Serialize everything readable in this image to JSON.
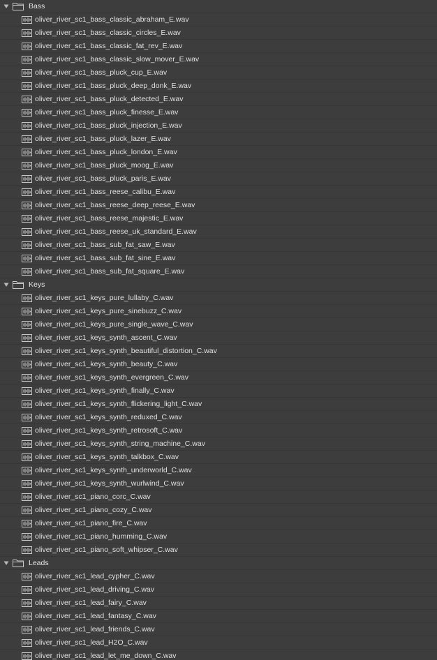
{
  "folders": [
    {
      "name": "Bass",
      "icon": "folder-icon",
      "files": [
        "oliver_river_sc1_bass_classic_abraham_E.wav",
        "oliver_river_sc1_bass_classic_circles_E.wav",
        "oliver_river_sc1_bass_classic_fat_rev_E.wav",
        "oliver_river_sc1_bass_classic_slow_mover_E.wav",
        "oliver_river_sc1_bass_pluck_cup_E.wav",
        "oliver_river_sc1_bass_pluck_deep_donk_E.wav",
        "oliver_river_sc1_bass_pluck_detected_E.wav",
        "oliver_river_sc1_bass_pluck_finesse_E.wav",
        "oliver_river_sc1_bass_pluck_injection_E.wav",
        "oliver_river_sc1_bass_pluck_lazer_E.wav",
        "oliver_river_sc1_bass_pluck_london_E.wav",
        "oliver_river_sc1_bass_pluck_moog_E.wav",
        "oliver_river_sc1_bass_pluck_paris_E.wav",
        "oliver_river_sc1_bass_reese_calibu_E.wav",
        "oliver_river_sc1_bass_reese_deep_reese_E.wav",
        "oliver_river_sc1_bass_reese_majestic_E.wav",
        "oliver_river_sc1_bass_reese_uk_standard_E.wav",
        "oliver_river_sc1_bass_sub_fat_saw_E.wav",
        "oliver_river_sc1_bass_sub_fat_sine_E.wav",
        "oliver_river_sc1_bass_sub_fat_square_E.wav"
      ]
    },
    {
      "name": "Keys",
      "icon": "folder-icon",
      "files": [
        "oliver_river_sc1_keys_pure_lullaby_C.wav",
        "oliver_river_sc1_keys_pure_sinebuzz_C.wav",
        "oliver_river_sc1_keys_pure_single_wave_C.wav",
        "oliver_river_sc1_keys_synth_ascent_C.wav",
        "oliver_river_sc1_keys_synth_beautiful_distortion_C.wav",
        "oliver_river_sc1_keys_synth_beauty_C.wav",
        "oliver_river_sc1_keys_synth_evergreen_C.wav",
        "oliver_river_sc1_keys_synth_finally_C.wav",
        "oliver_river_sc1_keys_synth_flickering_light_C.wav",
        "oliver_river_sc1_keys_synth_reduxed_C.wav",
        "oliver_river_sc1_keys_synth_retrosoft_C.wav",
        "oliver_river_sc1_keys_synth_string_machine_C.wav",
        "oliver_river_sc1_keys_synth_talkbox_C.wav",
        "oliver_river_sc1_keys_synth_underworld_C.wav",
        "oliver_river_sc1_keys_synth_wurlwind_C.wav",
        "oliver_river_sc1_piano_corc_C.wav",
        "oliver_river_sc1_piano_cozy_C.wav",
        "oliver_river_sc1_piano_fire_C.wav",
        "oliver_river_sc1_piano_humming_C.wav",
        "oliver_river_sc1_piano_soft_whipser_C.wav"
      ]
    },
    {
      "name": "Leads",
      "icon": "folder-icon",
      "files": [
        "oliver_river_sc1_lead_cypher_C.wav",
        "oliver_river_sc1_lead_driving_C.wav",
        "oliver_river_sc1_lead_fairy_C.wav",
        "oliver_river_sc1_lead_fantasy_C.wav",
        "oliver_river_sc1_lead_friends_C.wav",
        "oliver_river_sc1_lead_H2O_C.wav",
        "oliver_river_sc1_lead_let_me_down_C.wav"
      ]
    }
  ],
  "colors": {
    "background": "#3d3d3d",
    "text": "#e0e0e0",
    "icon": "#c8c8c8",
    "row_divider": "#363636"
  },
  "file_icon": "audio-waveform-icon",
  "disclosure_icon": "triangle-down-icon"
}
